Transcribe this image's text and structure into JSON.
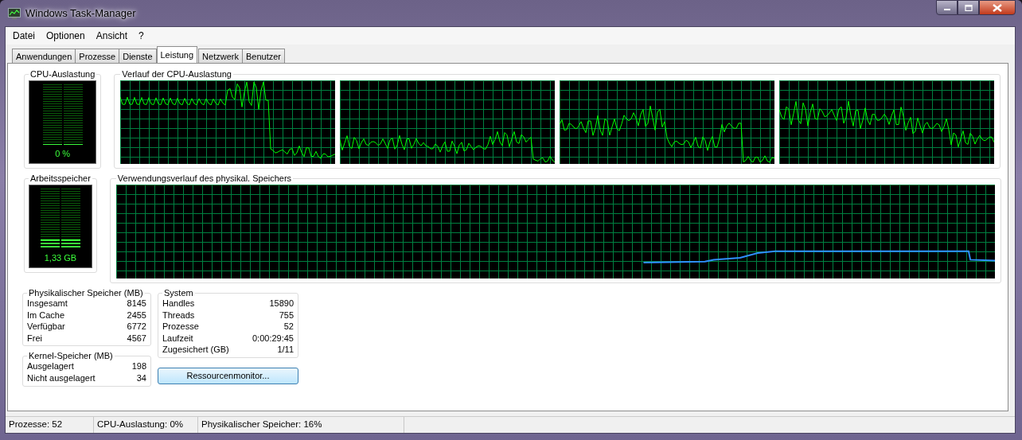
{
  "window": {
    "title": "Windows Task-Manager"
  },
  "menu": [
    "Datei",
    "Optionen",
    "Ansicht",
    "?"
  ],
  "tabs": [
    {
      "label": "Anwendungen",
      "selected": false
    },
    {
      "label": "Prozesse",
      "selected": false
    },
    {
      "label": "Dienste",
      "selected": false
    },
    {
      "label": "Leistung",
      "selected": true
    },
    {
      "label": "Netzwerk",
      "selected": false
    },
    {
      "label": "Benutzer",
      "selected": false
    }
  ],
  "cpu_usage": {
    "title": "CPU-Auslastung",
    "reading": "0 %",
    "level": 0
  },
  "cpu_history": {
    "title": "Verlauf der CPU-Auslastung"
  },
  "memory": {
    "title": "Arbeitsspeicher",
    "reading": "1,33 GB",
    "level": 0.16
  },
  "memory_history": {
    "title": "Verwendungsverlauf des physikal. Speichers"
  },
  "physical_memory": {
    "title": "Physikalischer Speicher (MB)",
    "rows": [
      {
        "label": "Insgesamt",
        "value": "8145"
      },
      {
        "label": "Im Cache",
        "value": "2455"
      },
      {
        "label": "Verfügbar",
        "value": "6772"
      },
      {
        "label": "Frei",
        "value": "4567"
      }
    ]
  },
  "kernel_memory": {
    "title": "Kernel-Speicher (MB)",
    "rows": [
      {
        "label": "Ausgelagert",
        "value": "198"
      },
      {
        "label": "Nicht ausgelagert",
        "value": "34"
      }
    ]
  },
  "system": {
    "title": "System",
    "rows": [
      {
        "label": "Handles",
        "value": "15890"
      },
      {
        "label": "Threads",
        "value": "755"
      },
      {
        "label": "Prozesse",
        "value": "52"
      },
      {
        "label": "Laufzeit",
        "value": "0:00:29:45"
      },
      {
        "label": "Zugesichert (GB)",
        "value": "1/11"
      }
    ]
  },
  "resource_monitor_button": "Ressourcenmonitor...",
  "status_bar": [
    "Prozesse: 52",
    "CPU-Auslastung: 0%",
    "Physikalischer Speicher: 16%"
  ]
}
